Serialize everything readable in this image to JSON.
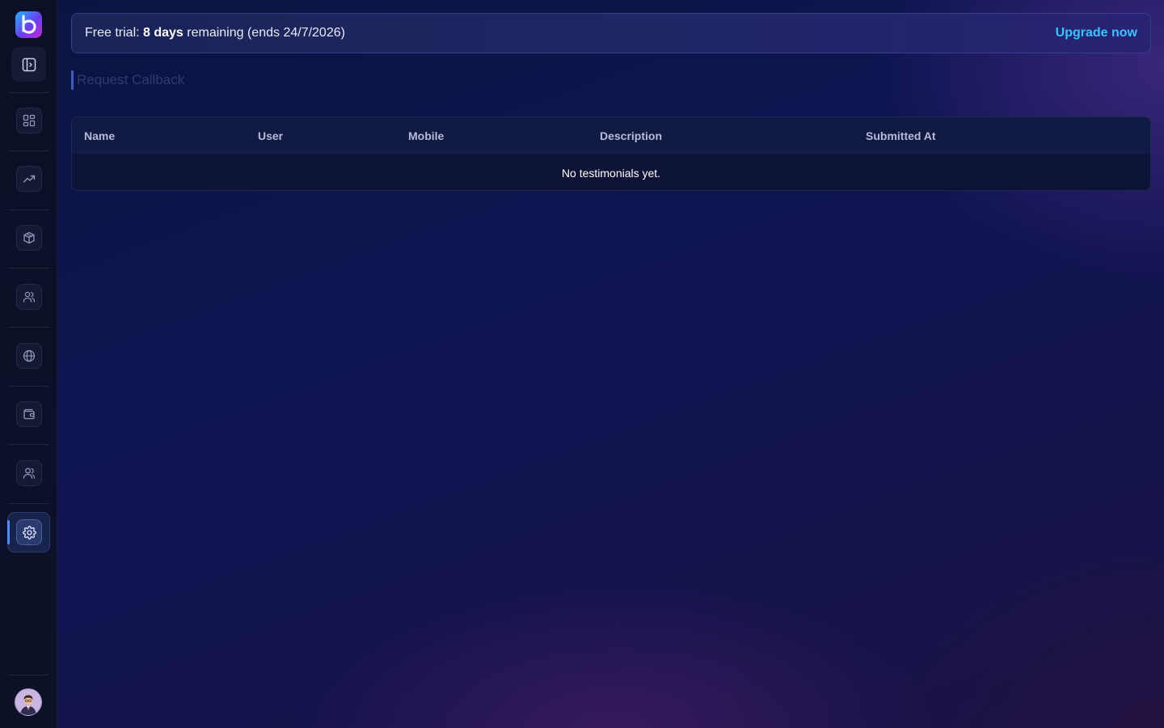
{
  "sidebar": {
    "logo_icon": "brand-b-logo",
    "collapse_icon": "sidebar-panel-icon",
    "items": [
      {
        "icon": "dashboard-grid-icon",
        "active": false
      },
      {
        "icon": "trending-up-icon",
        "active": false
      },
      {
        "icon": "package-box-icon",
        "active": false
      },
      {
        "icon": "users-icon",
        "active": false
      },
      {
        "icon": "globe-icon",
        "active": false
      },
      {
        "icon": "wallet-icon",
        "active": false
      },
      {
        "icon": "team-icon",
        "active": false
      },
      {
        "icon": "settings-gear-icon",
        "active": true
      }
    ],
    "avatar_icon": "user-avatar"
  },
  "banner": {
    "prefix": "Free trial: ",
    "days": "8 days",
    "suffix": " remaining (ends 24/7/2026)",
    "upgrade_label": "Upgrade now"
  },
  "page": {
    "title": "Request Callback"
  },
  "table": {
    "columns": [
      "Name",
      "User",
      "Mobile",
      "Description",
      "Submitted At"
    ],
    "empty_message": "No testimonials yet."
  },
  "colors": {
    "accent": "#38c4ff",
    "active_indicator": "#4f8cff",
    "background": "#0d1550"
  }
}
